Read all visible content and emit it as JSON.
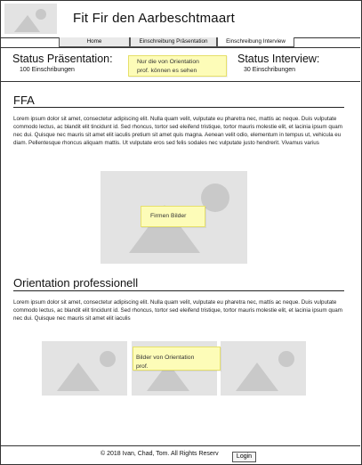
{
  "header": {
    "title": "Fit Fir den Aarbeschtmaart",
    "logo_icon": "image-placeholder-icon"
  },
  "nav": {
    "items": [
      {
        "label": "Home"
      },
      {
        "label": "Einschreibung Präsentation"
      },
      {
        "label": "Einschreibung Interview"
      }
    ]
  },
  "status": {
    "presentation": {
      "title": "Status Präsentation:",
      "count": "100 Einschribungen"
    },
    "note": {
      "line1": "Nur die von Orientation",
      "line2": "prof. können es sehen"
    },
    "interview": {
      "title": "Status Interview:",
      "count": "30 Einschribungen"
    }
  },
  "ffa": {
    "heading": "FFA",
    "text": "Lorem ipsum dolor sit amet, consectetur adipiscing elit. Nulla quam velit, vulputate eu pharetra nec, mattis ac neque. Duis vulputate commodo lectus, ac blandit elit tincidunt id. Sed rhoncus, tortor sed eleifend tristique, tortor mauris molestie elit, et lacinia ipsum quam nec dui. Quisque nec mauris sit amet elit iaculis pretium sit amet quis magna. Aenean velit odio, elementum in tempus ut, vehicula eu diam. Pellentesque rhoncus aliquam mattis. Ut vulputate eros sed felis sodales nec vulputate justo hendrerit. Vivamus varius",
    "image_note": "Firmen Bilder"
  },
  "orientation": {
    "heading": "Orientation professionell",
    "text": "Lorem ipsum dolor sit amet, consectetur adipiscing elit. Nulla quam velit, vulputate eu pharetra nec, mattis ac neque. Duis vulputate commodo lectus, ac blandit elit tincidunt id. Sed rhoncus, tortor sed eleifend tristique, tortor mauris molestie elit, et lacinia ipsum quam nec dui. Quisque nec mauris sit amet elit iaculis",
    "image_note": {
      "line1": "Bilder von  Orientation",
      "line2": "prof."
    }
  },
  "footer": {
    "copyright": "© 2018 Ivan, Chad, Tom. All Rights Reserv",
    "login_label": "Login"
  }
}
